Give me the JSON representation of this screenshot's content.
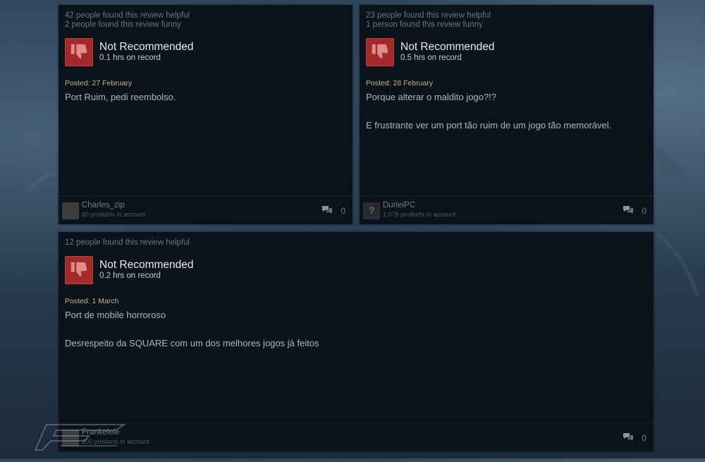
{
  "reviews": [
    {
      "helpful": "42 people found this review helpful",
      "funny": "2 people found this review funny",
      "verdict": "Not Recommended",
      "hours": "0.1 hrs on record",
      "posted": "Posted: 27 February",
      "body": [
        "Port Ruim, pedi reembolso."
      ],
      "username": "Charles_zip",
      "products": "80 products in account",
      "comments": "0",
      "icon": "thumbs-down-icon"
    },
    {
      "helpful": "23 people found this review helpful",
      "funny": "1 person found this review funny",
      "verdict": "Not Recommended",
      "hours": "0.5 hrs on record",
      "posted": "Posted: 28 February",
      "body": [
        "Porque alterar o maldito jogo?!?",
        "E frustrante ver um port tão ruim de um jogo tão memorável."
      ],
      "username": "DurleiPC",
      "products": "1,078 products in account",
      "comments": "0",
      "avatar_glyph": "?"
    },
    {
      "helpful": "12 people found this review helpful",
      "verdict": "Not Recommended",
      "hours": "0.2 hrs on record",
      "posted": "Posted: 1 March",
      "body": [
        "Port de mobile horroroso",
        "Desrespeito da SQUARE com um dos melhores jogos já feitos"
      ],
      "username": "Frankelele",
      "products": "200 products in account",
      "comments": "0"
    }
  ],
  "colors": {
    "thumb_down": "#a32a2a",
    "card_bg": "#0b121b",
    "posted": "#c2b48a"
  }
}
